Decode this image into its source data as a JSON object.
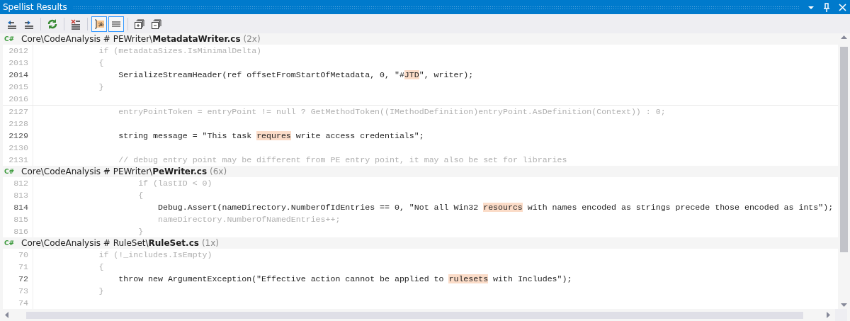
{
  "window": {
    "title": "Spellist Results"
  },
  "title_buttons": [
    {
      "kind": "dropdown"
    },
    {
      "kind": "pin"
    },
    {
      "kind": "close"
    }
  ],
  "toolbar": [
    {
      "kind": "previous",
      "selected": false
    },
    {
      "kind": "next",
      "selected": false
    },
    {
      "kind": "sep"
    },
    {
      "kind": "refresh",
      "selected": false
    },
    {
      "kind": "sep"
    },
    {
      "kind": "clear",
      "selected": false
    },
    {
      "kind": "sep"
    },
    {
      "kind": "highlight",
      "selected": true
    },
    {
      "kind": "lines",
      "selected": true
    },
    {
      "kind": "sep"
    },
    {
      "kind": "expand",
      "selected": false
    },
    {
      "kind": "collapse",
      "selected": false
    }
  ],
  "groups": [
    {
      "lang": "C#",
      "path": "Core\\CodeAnalysis # PEWriter\\",
      "file": "MetadataWriter.cs",
      "count": "(2x)",
      "snippets": [
        [
          {
            "num": "2012",
            "match": false,
            "text": "            if (metadataSizes.IsMinimalDelta)"
          },
          {
            "num": "2013",
            "match": false,
            "text": "            {"
          },
          {
            "num": "2014",
            "match": true,
            "text": "                SerializeStreamHeader(ref offsetFromStartOfMetadata, 0, \"#",
            "word": "JTD",
            "after": "\", writer);"
          },
          {
            "num": "2015",
            "match": false,
            "text": "            }"
          },
          {
            "num": "2016",
            "match": false
          }
        ],
        [
          {
            "num": "2127",
            "match": false,
            "text": "                entryPointToken = entryPoint != null ? GetMethodToken((IMethodDefinition)entryPoint.AsDefinition(Context)) : 0;"
          },
          {
            "num": "2128",
            "match": false
          },
          {
            "num": "2129",
            "match": true,
            "text": "                string message = \"This task ",
            "word": "requres",
            "after": " write access credentials\";"
          },
          {
            "num": "2130",
            "match": false
          },
          {
            "num": "2131",
            "match": false,
            "text": "                // debug entry point may be different from PE entry point, it may also be set for libraries"
          }
        ]
      ]
    },
    {
      "lang": "C#",
      "path": "Core\\CodeAnalysis # PEWriter\\",
      "file": "PeWriter.cs",
      "count": "(6x)",
      "snippets": [
        [
          {
            "num": "812",
            "match": false,
            "text": "                    if (lastID < 0)"
          },
          {
            "num": "813",
            "match": false,
            "text": "                    {"
          },
          {
            "num": "814",
            "match": true,
            "text": "                        Debug.Assert(nameDirectory.NumberOfIdEntries == 0, \"Not all Win32 ",
            "word": "resourcs",
            "after": " with names encoded as strings precede those encoded as ints\");"
          },
          {
            "num": "815",
            "match": false,
            "text": "                        nameDirectory.NumberOfNamedEntries++;"
          },
          {
            "num": "816",
            "match": false,
            "text": "                    }"
          }
        ]
      ]
    },
    {
      "lang": "C#",
      "path": "Core\\CodeAnalysis # RuleSet\\",
      "file": "RuleSet.cs",
      "count": "(1x)",
      "snippets": [
        [
          {
            "num": "70",
            "match": false,
            "text": "            if (!_includes.IsEmpty)"
          },
          {
            "num": "71",
            "match": false,
            "text": "            {"
          },
          {
            "num": "72",
            "match": true,
            "text": "                throw new ArgumentException(\"Effective action cannot be applied to ",
            "word": "rulesets",
            "after": " with Includes\");"
          },
          {
            "num": "73",
            "match": false,
            "text": "            }"
          },
          {
            "num": "74",
            "match": false
          }
        ]
      ]
    }
  ]
}
